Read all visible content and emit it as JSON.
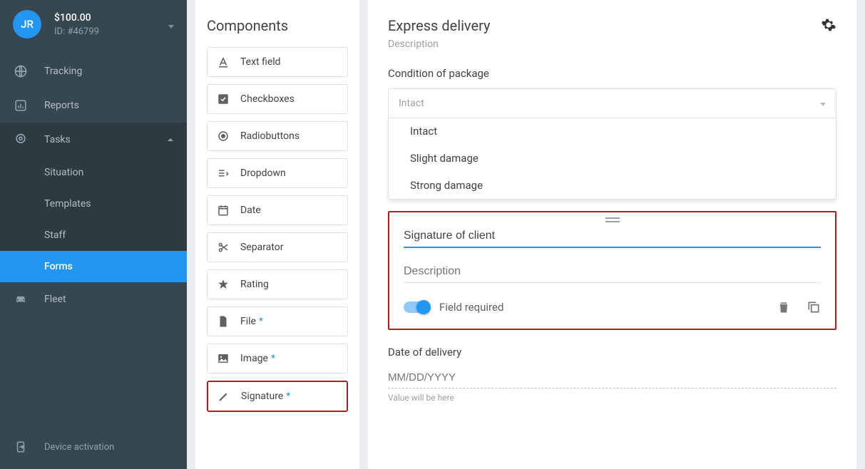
{
  "user": {
    "initials": "JR",
    "balance": "$100.00",
    "id_label": "ID: #46799"
  },
  "nav": {
    "tracking": "Tracking",
    "reports": "Reports",
    "tasks": "Tasks",
    "subs": {
      "situation": "Situation",
      "templates": "Templates",
      "staff": "Staff",
      "forms": "Forms"
    },
    "fleet": "Fleet",
    "activation": "Device activation"
  },
  "components": {
    "title": "Components",
    "items": {
      "text_field": "Text field",
      "checkboxes": "Checkboxes",
      "radiobuttons": "Radiobuttons",
      "dropdown": "Dropdown",
      "date": "Date",
      "separator": "Separator",
      "rating": "Rating",
      "file": "File",
      "image": "Image",
      "signature": "Signature"
    },
    "star": "*"
  },
  "editor": {
    "title": "Express delivery",
    "description": "Description",
    "condition_label": "Condition of package",
    "condition_value": "Intact",
    "condition_options": {
      "o0": "Intact",
      "o1": "Slight damage",
      "o2": "Strong damage"
    },
    "sig_field_name": "Signature of client",
    "desc_placeholder": "Description",
    "required_label": "Field required",
    "date_label": "Date of delivery",
    "date_placeholder": "MM/DD/YYYY",
    "date_hint": "Value will be here"
  }
}
